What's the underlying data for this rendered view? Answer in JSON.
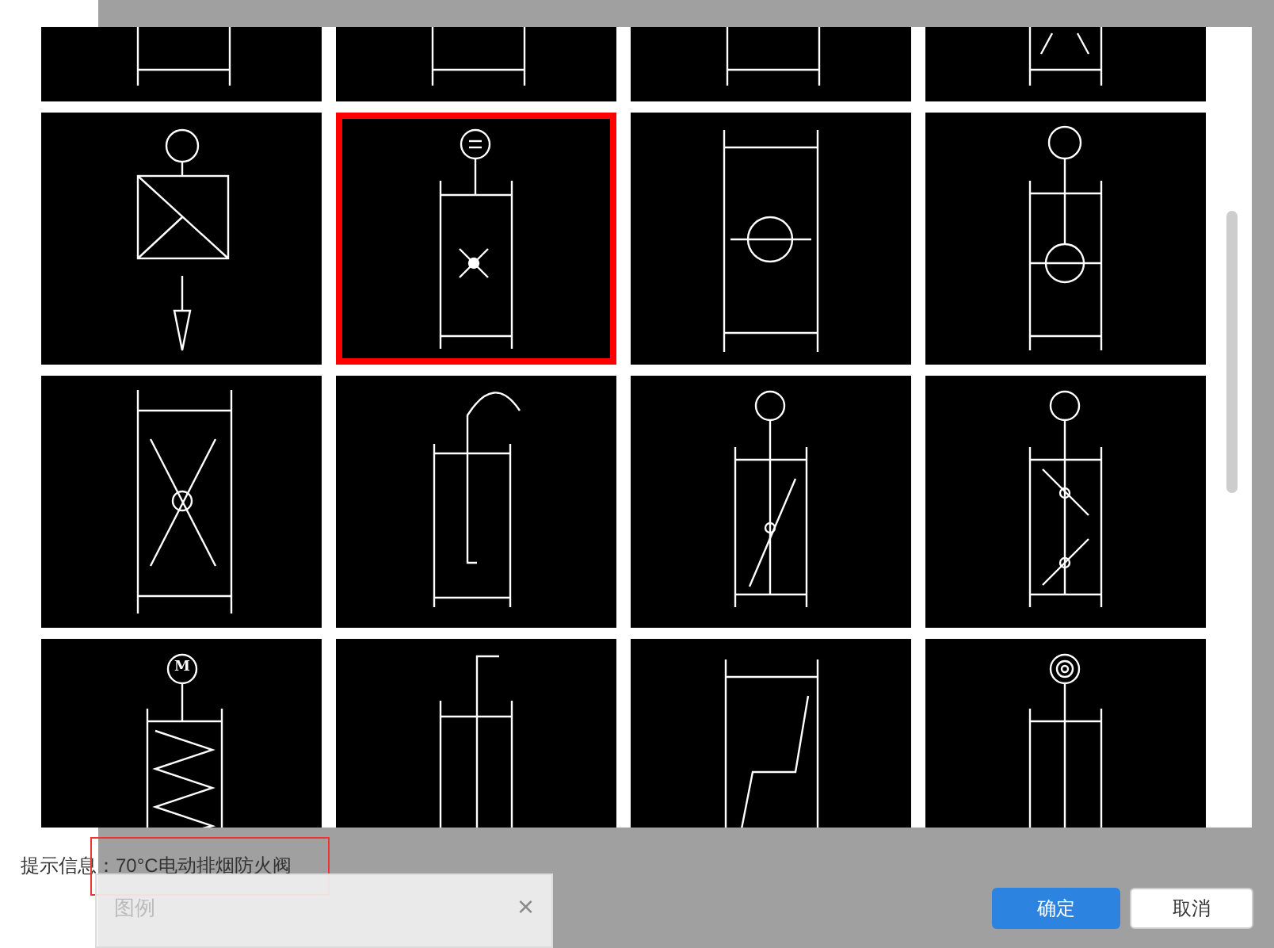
{
  "symbols": [
    {
      "kind": "frame",
      "selected": false
    },
    {
      "kind": "frame",
      "selected": false
    },
    {
      "kind": "frame",
      "selected": false
    },
    {
      "kind": "frame-v",
      "selected": false
    },
    {
      "kind": "actuator-arrow",
      "selected": false
    },
    {
      "kind": "damper-cross",
      "selected": true
    },
    {
      "kind": "round-valve",
      "selected": false
    },
    {
      "kind": "stem-valve",
      "selected": false
    },
    {
      "kind": "x-valve",
      "selected": false
    },
    {
      "kind": "hook",
      "selected": false
    },
    {
      "kind": "diagonal-valve",
      "selected": false
    },
    {
      "kind": "double-valve",
      "selected": false
    },
    {
      "kind": "motor-spring",
      "selected": false,
      "label": "M"
    },
    {
      "kind": "stub",
      "selected": false
    },
    {
      "kind": "zigzag",
      "selected": false
    },
    {
      "kind": "target",
      "selected": false
    }
  ],
  "hint": "提示信息：70°C电动排烟防火阀",
  "legend_panel": {
    "title": "图例",
    "close": "×"
  },
  "buttons": [
    {
      "label": "确定",
      "kind": "primary"
    },
    {
      "label": "取消",
      "kind": "secondary"
    }
  ]
}
